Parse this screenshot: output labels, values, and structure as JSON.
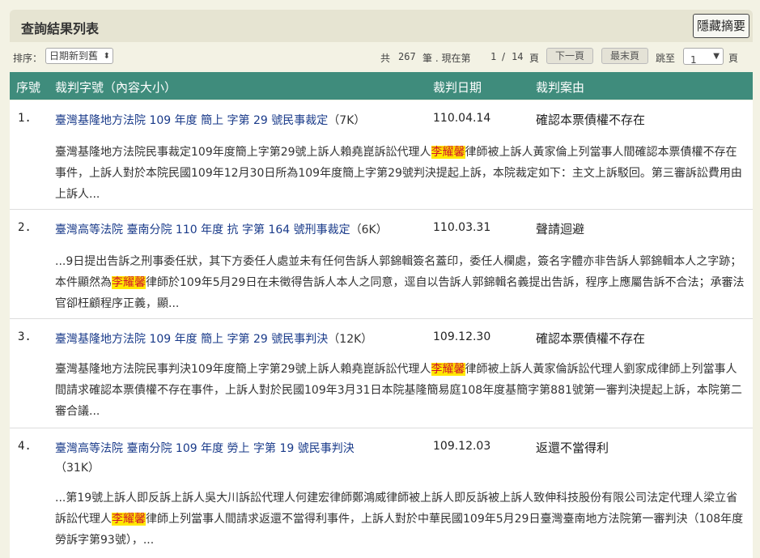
{
  "header": {
    "title": "查詢結果列表",
    "hide_summary_label": "隱藏摘要"
  },
  "toolbar": {
    "sort_label": "排序：",
    "sort_value": "日期新到舊",
    "total_prefix": "共",
    "total_count": "267",
    "total_suffix": "筆 . 現在第",
    "current_page": "1",
    "page_sep": "/",
    "total_pages": "14",
    "page_suffix": "頁",
    "next_page_label": "下一頁",
    "last_page_label": "最末頁",
    "goto_label": "跳至",
    "goto_value": "1",
    "goto_suffix": "頁"
  },
  "table": {
    "headers": {
      "index": "序號",
      "case_no": "裁判字號（內容大小）",
      "date": "裁判日期",
      "reason": "裁判案由"
    },
    "rows": [
      {
        "num": "1.",
        "court": "臺灣基隆地方法院",
        "year": "109",
        "year_label": "年度",
        "word": "簡上",
        "word_label": "字第",
        "no": "29",
        "type": "號民事裁定",
        "size": "（7K）",
        "date": "110.04.14",
        "reason": "確認本票債權不存在",
        "summary_pre": "臺灣基隆地方法院民事裁定109年度簡上字第29號上訴人賴堯崑訴訟代理人",
        "highlight": "李耀馨",
        "summary_post": "律師被上訴人黃家倫上列當事人間確認本票債權不存在事件，上訴人對於本院民國109年12月30日所為109年度簡上字第29號判決提起上訴，本院裁定如下：主文上訴駁回。第三審訴訟費用由上訴人..."
      },
      {
        "num": "2.",
        "court": "臺灣高等法院 臺南分院",
        "year": "110",
        "year_label": "年度",
        "word": "抗",
        "word_label": "字第",
        "no": "164",
        "type": "號刑事裁定",
        "size": "（6K）",
        "date": "110.03.31",
        "reason": "聲請迴避",
        "summary_pre": "...9日提出告訴之刑事委任狀，其下方委任人處並未有任何告訴人郭錦輯簽名蓋印，委任人欄處，簽名字體亦非告訴人郭錦輯本人之字跡；本件顯然為",
        "highlight": "李耀馨",
        "summary_post": "律師於109年5月29日在未徵得告訴人本人之同意，逕自以告訴人郭錦輯名義提出告訴，程序上應屬告訴不合法；承審法官卻枉顧程序正義，顯..."
      },
      {
        "num": "3.",
        "court": "臺灣基隆地方法院",
        "year": "109",
        "year_label": "年度",
        "word": "簡上",
        "word_label": "字第",
        "no": "29",
        "type": "號民事判決",
        "size": "（12K）",
        "date": "109.12.30",
        "reason": "確認本票債權不存在",
        "summary_pre": "臺灣基隆地方法院民事判決109年度簡上字第29號上訴人賴堯崑訴訟代理人",
        "highlight": "李耀馨",
        "summary_post": "律師被上訴人黃家倫訴訟代理人劉家成律師上列當事人間請求確認本票債權不存在事件，上訴人對於民國109年3月31日本院基隆簡易庭108年度基簡字第881號第一審判決提起上訴，本院第二審合議..."
      },
      {
        "num": "4.",
        "court": "臺灣高等法院 臺南分院",
        "year": "109",
        "year_label": "年度",
        "word": "勞上",
        "word_label": "字第",
        "no": "19",
        "type": "號民事判決",
        "size": "（31K）",
        "date": "109.12.03",
        "reason": "返還不當得利",
        "summary_pre": "...第19號上訴人即反訴上訴人吳大川訴訟代理人何建宏律師鄭鴻威律師被上訴人即反訴被上訴人致伸科技股份有限公司法定代理人梁立省訴訟代理人",
        "highlight": "李耀馨",
        "summary_post": "律師上列當事人間請求返還不當得利事件，上訴人對於中華民國109年5月29日臺灣臺南地方法院第一審判決（108年度勞訴字第93號），..."
      }
    ]
  },
  "colors": {
    "header_green": "#3f8c7c",
    "link_blue": "#1a3b8a",
    "highlight_bg": "#ffe800",
    "highlight_text": "#d0142c"
  }
}
